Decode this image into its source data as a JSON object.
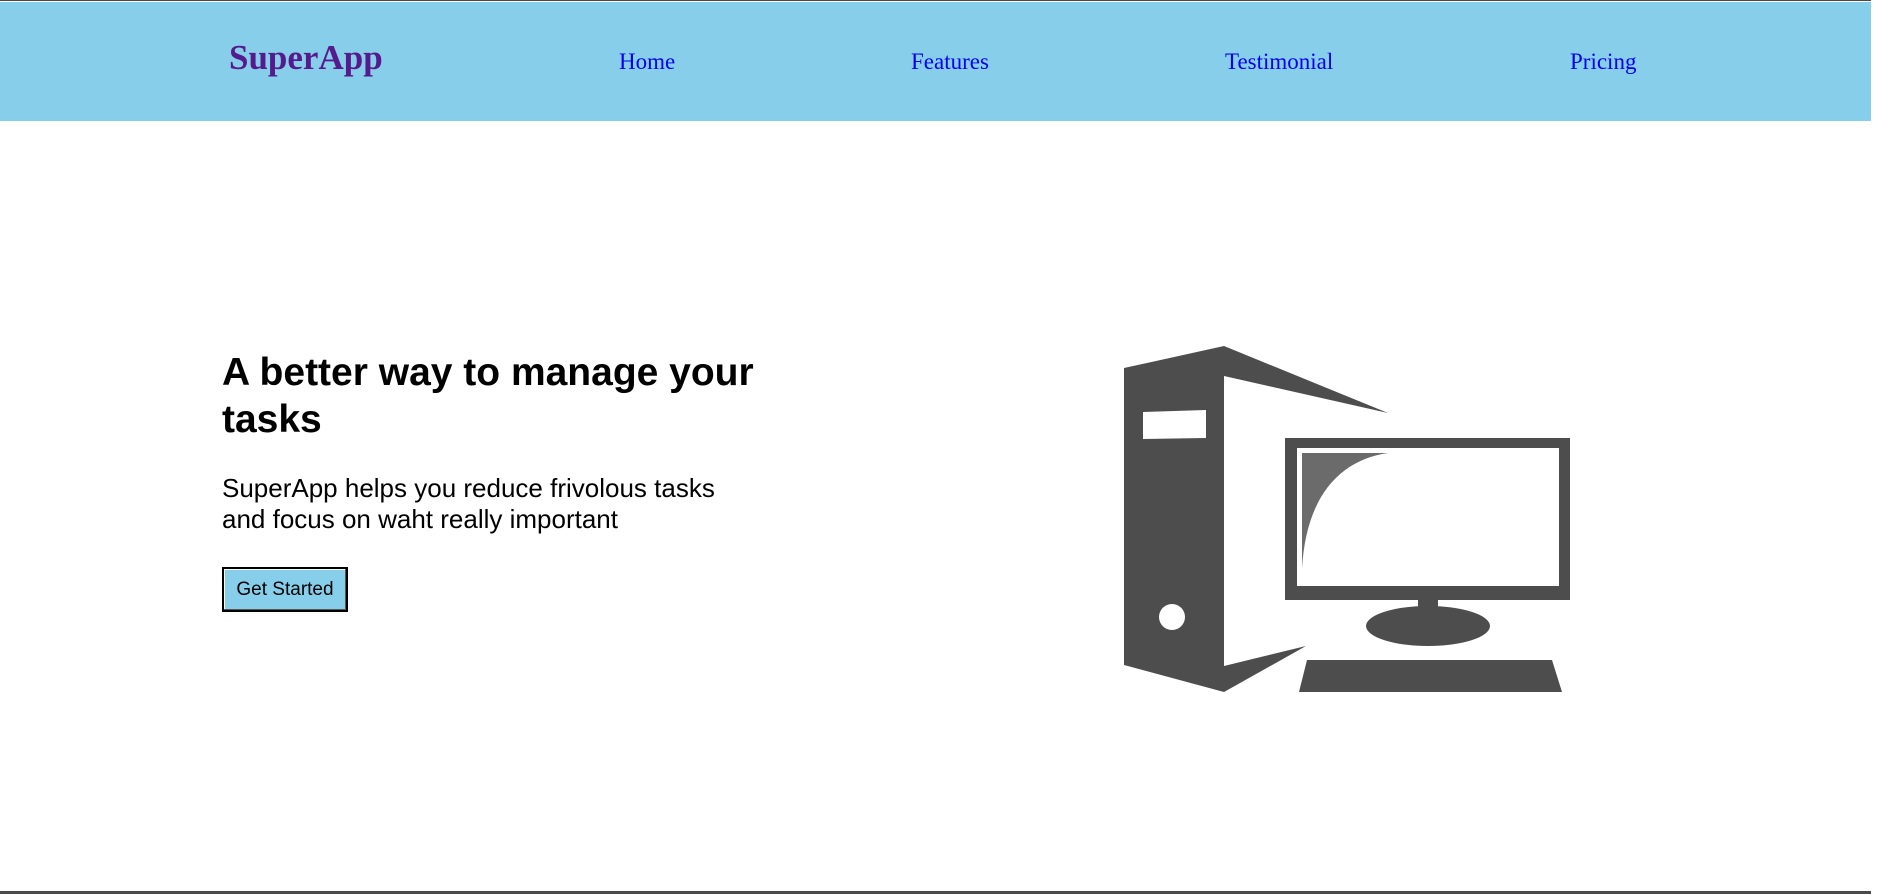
{
  "nav": {
    "logo": "SuperApp",
    "links": [
      "Home",
      "Features",
      "Testimonial",
      "Pricing"
    ]
  },
  "hero": {
    "title": "A better way to manage your tasks",
    "subtitle": "SuperApp helps you reduce frivolous tasks and focus on waht really important",
    "cta_label": "Get Started"
  },
  "illustration": {
    "icon": "desktop-computer-icon",
    "color": "#4d4d4d"
  },
  "colors": {
    "navbar": "#87ceeb",
    "logo": "#551a8b",
    "links": "#0000ee",
    "button": "#87ceeb"
  }
}
